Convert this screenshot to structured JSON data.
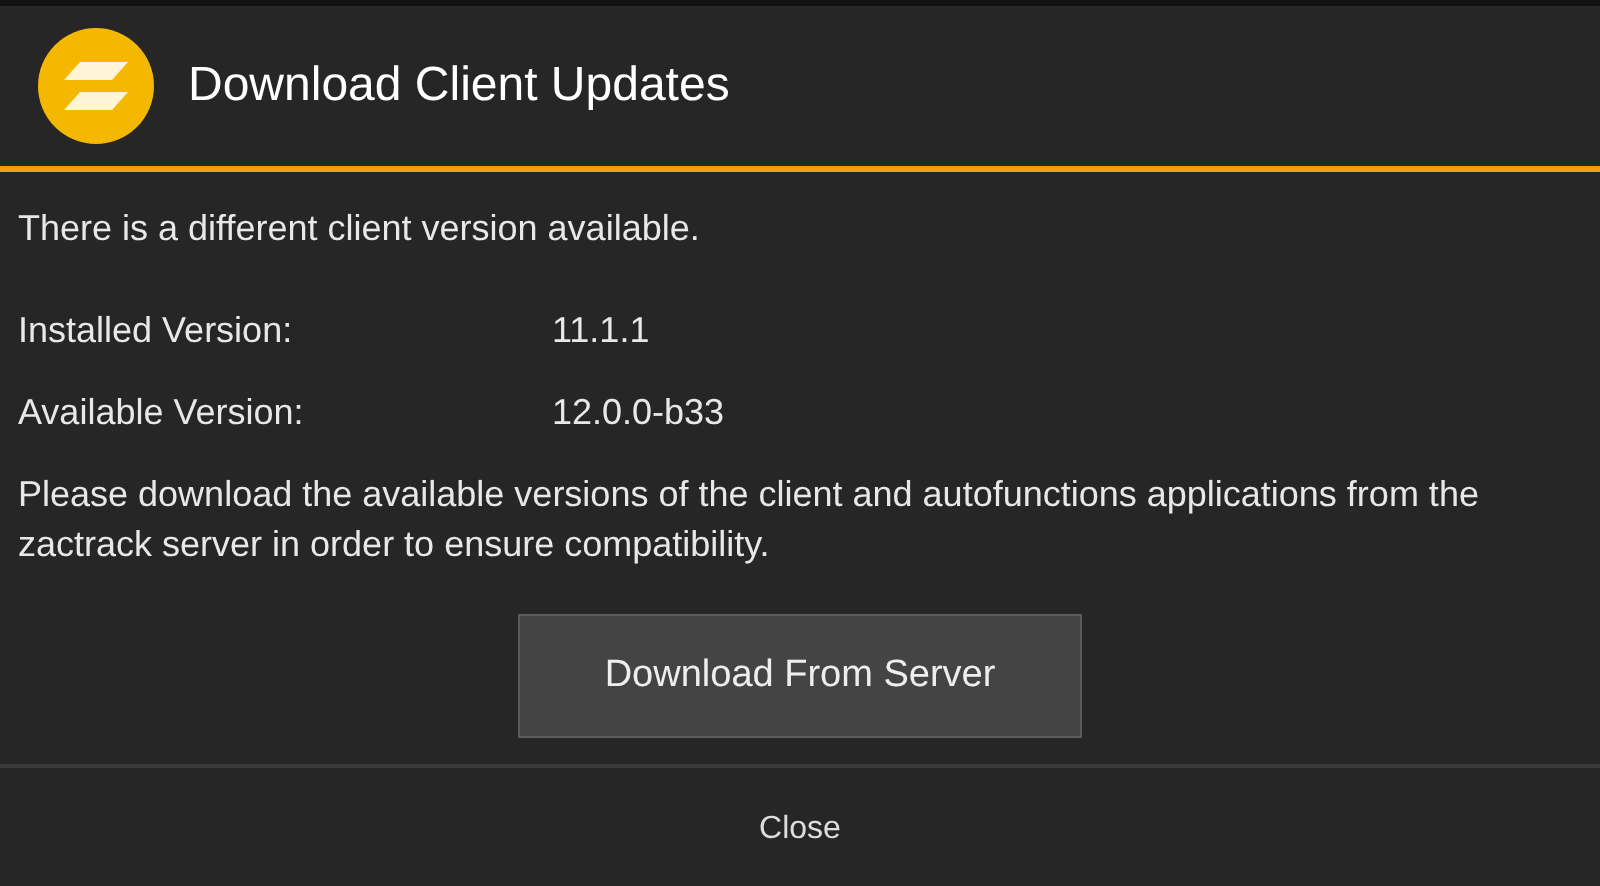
{
  "dialog": {
    "title": "Download Client Updates",
    "message": "There is a different client version available.",
    "versions": [
      {
        "label": "Installed Version:",
        "value": "11.1.1"
      },
      {
        "label": "Available Version:",
        "value": "12.0.0-b33"
      }
    ],
    "note": "Please download the available versions of the client and autofunctions applications from the zactrack server in order to ensure compatibility.",
    "action_button": "Download From Server",
    "close_button": "Close"
  }
}
